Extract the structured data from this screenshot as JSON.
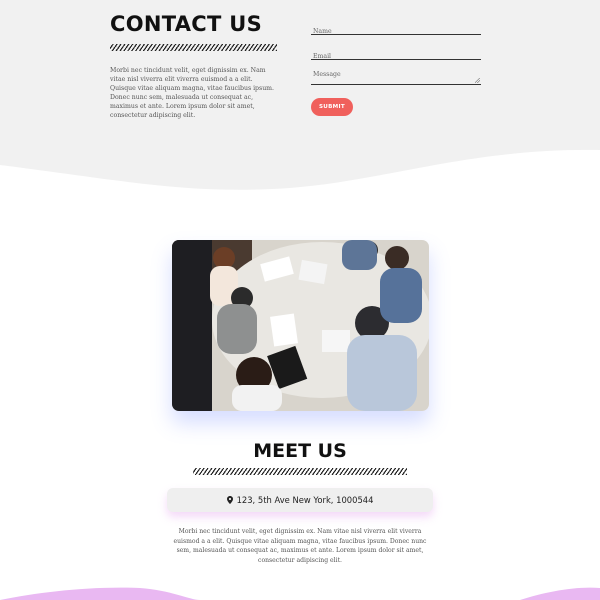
{
  "contact": {
    "title": "CONTACT US",
    "body": "Morbi nec tincidunt velit, eget dignissim ex. Nam vitae nisl viverra elit viverra euismod a a elit. Quisque vitae aliquam magna, vitae faucibus ipsum. Donec nunc sem, malesuada ut consequat ac, maximus et ante. Lorem ipsum dolor sit amet, consectetur adipiscing elit.",
    "form": {
      "name_placeholder": "Name",
      "email_placeholder": "Email",
      "message_placeholder": "Message",
      "submit_label": "SUBMIT"
    }
  },
  "meet": {
    "title": "MEET US",
    "address": "123, 5th Ave New York, 1000544",
    "body": "Morbi nec tincidunt velit, eget dignissim ex. Nam vitae nisl viverra elit viverra euismod a a elit. Quisque vitae aliquam magna, vitae faucibus ipsum. Donec nunc sem, malesuada ut consequat ac, maximus et ante. Lorem ipsum dolor sit amet, consectetur adipiscing elit.",
    "photo_icon": "team-meeting-photo",
    "address_icon": "map-pin-icon"
  },
  "colors": {
    "background_gray": "#f1f1f1",
    "submit_button": "#f0605c",
    "photo_glow": "#5a78ff",
    "bottom_wave": "#e6a9f0"
  }
}
